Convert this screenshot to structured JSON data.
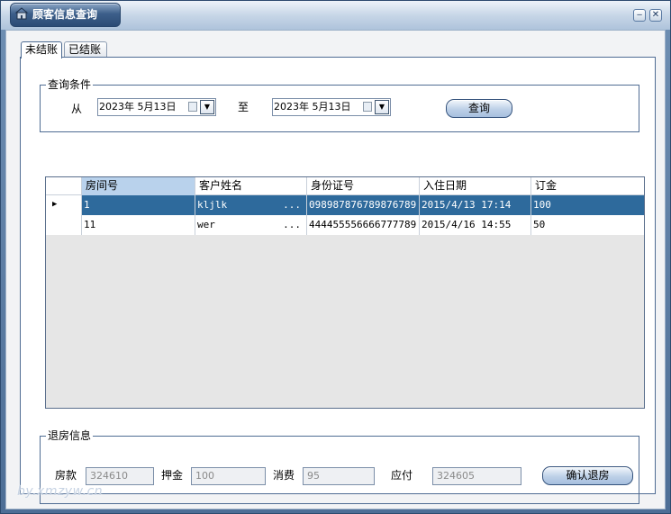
{
  "window": {
    "title": "顾客信息查询"
  },
  "tabs": [
    {
      "label": "未结账",
      "active": true
    },
    {
      "label": "已结账",
      "active": false
    }
  ],
  "query": {
    "group_label": "查询条件",
    "from_label": "从",
    "to_label": "至",
    "from_date": "2023年 5月13日",
    "to_date": "2023年 5月13日",
    "search_label": "查询"
  },
  "grid": {
    "columns": [
      "房间号",
      "客户姓名",
      "身份证号",
      "入住日期",
      "订金"
    ],
    "rows": [
      {
        "room": "1",
        "name": "kljlk",
        "id_no": "098987876789876789",
        "checkin": "2015/4/13 17:14",
        "deposit": "100",
        "selected": true
      },
      {
        "room": "11",
        "name": "wer",
        "id_no": "444455556666777789",
        "checkin": "2015/4/16 14:55",
        "deposit": "50",
        "selected": false
      }
    ],
    "ellipsis": "..."
  },
  "checkout": {
    "group_label": "退房信息",
    "room_fee_label": "房款",
    "room_fee": "324610",
    "deposit_label": "押金",
    "deposit": "100",
    "consume_label": "消费",
    "consume": "95",
    "payable_label": "应付",
    "payable": "324605",
    "confirm_label": "确认退房"
  },
  "watermark": "by.xmzyw.cn",
  "colors": {
    "selected_row": "#2e6a9c",
    "header_selected": "#b9d2ec",
    "border": "#4f6c93"
  }
}
